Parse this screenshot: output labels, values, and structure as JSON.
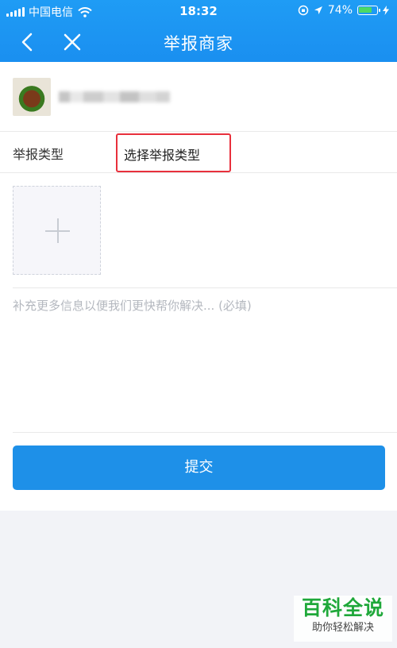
{
  "status_bar": {
    "carrier": "中国电信",
    "time": "18:32",
    "battery": "74%",
    "battery_level": 0.74
  },
  "nav": {
    "title": "举报商家",
    "back_icon": "chevron-left-icon",
    "close_icon": "close-icon"
  },
  "shop": {
    "thumbnail": "food-thumbnail",
    "name_blurred": true
  },
  "report_type": {
    "label": "举报类型",
    "select_text": "选择举报类型",
    "highlight_color": "#e8303c"
  },
  "photo_upload": {
    "icon": "plus-icon"
  },
  "description": {
    "placeholder": "补充更多信息以便我们更快帮你解决... (必填)",
    "value": ""
  },
  "submit": {
    "label": "提交",
    "color": "#1e90e8"
  },
  "watermark": {
    "title": "百科全说",
    "subtitle": "助你轻松解决",
    "color": "#1fa83a"
  },
  "colors": {
    "header": "#1a8ff0",
    "page_bg": "#f2f3f7"
  }
}
